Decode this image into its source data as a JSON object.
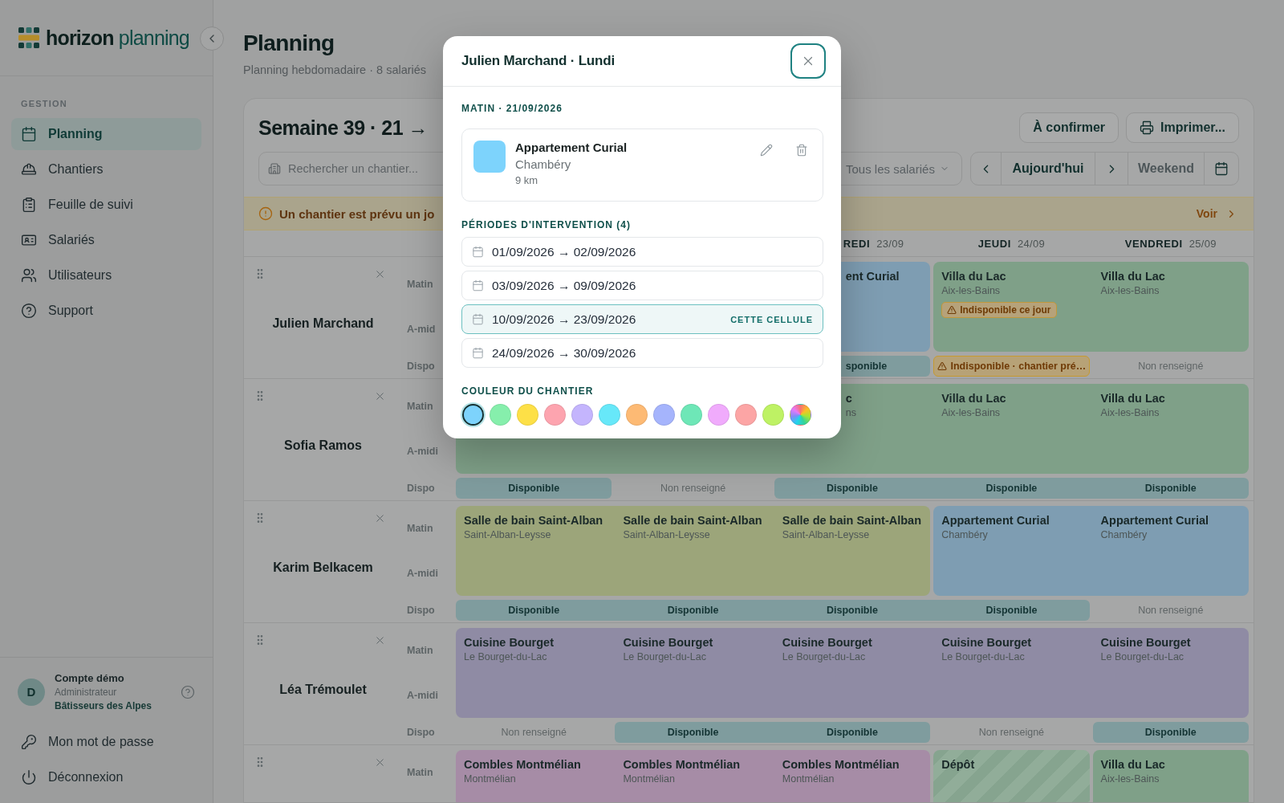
{
  "sidebar": {
    "logo": {
      "first": "horizon",
      "second": "planning"
    },
    "section": "GESTION",
    "items": [
      {
        "label": "Planning",
        "selected": true
      },
      {
        "label": "Chantiers",
        "selected": false
      },
      {
        "label": "Feuille de suivi",
        "selected": false
      },
      {
        "label": "Salariés",
        "selected": false
      },
      {
        "label": "Utilisateurs",
        "selected": false
      },
      {
        "label": "Support",
        "selected": false
      }
    ],
    "account": {
      "initial": "D",
      "name": "Compte démo",
      "role": "Administrateur",
      "company": "Bâtisseurs des Alpes"
    },
    "footer_links": [
      "Mon mot de passe",
      "Déconnexion"
    ]
  },
  "header": {
    "title": "Planning",
    "subtitle": "Planning hebdomadaire · 8 salariés"
  },
  "week": {
    "title": "Semaine 39 · 21 →",
    "actions": [
      "À confirmer",
      "Imprimer..."
    ],
    "search": {
      "placeholder": "Rechercher un chantier..."
    },
    "filter": {
      "value": "Tous les salariés"
    },
    "nav": {
      "today": "Aujourd'hui",
      "weekend": "Weekend"
    }
  },
  "alert": {
    "text": "Un chantier est prévu un jo",
    "link": "Voir"
  },
  "days": [
    {
      "day": "REDI",
      "date": "23/09"
    },
    {
      "day": "JEUDI",
      "date": "24/09"
    },
    {
      "day": "VENDREDI",
      "date": "25/09"
    }
  ],
  "rows": [
    {
      "name": "Julien Marchand",
      "labels": [
        "Matin",
        "A-mid",
        "Dispo"
      ],
      "work": [
        {
          "kind": "site",
          "color": "#7e9db2",
          "days": [
            {
              "title": "ent Curial"
            }
          ]
        },
        {
          "kind": "site",
          "color": "#7fa088",
          "days": [
            {
              "title": "Villa du Lac",
              "city": "Aix-les-Bains",
              "warning": "Indisponible ce jour"
            },
            {
              "title": "Villa du Lac",
              "city": "Aix-les-Bains"
            }
          ]
        }
      ],
      "dispo": [
        {
          "kind": "available",
          "days": [
            "sponible"
          ]
        },
        {
          "kind": "unavailable",
          "days": [
            "Indisponible · chantier pré…"
          ]
        },
        {
          "kind": "unset",
          "days": [
            "Non renseigné"
          ]
        }
      ]
    },
    {
      "name": "Sofia Ramos",
      "labels": [
        "Matin",
        "A-midi",
        "Dispo"
      ],
      "work": [
        {
          "kind": "site",
          "color": "#7fa088",
          "days": [
            {
              "title": "c",
              "city": "ns"
            },
            {
              "title": "Villa du Lac",
              "city": "Aix-les-Bains"
            },
            {
              "title": "Villa du Lac",
              "city": "Aix-les-Bains"
            }
          ]
        }
      ],
      "dispo": [
        {
          "kind": "available",
          "days": [
            "Disponible"
          ]
        },
        {
          "kind": "unset",
          "days": [
            "Non renseigné"
          ]
        },
        {
          "kind": "available",
          "days": [
            "Disponible",
            "Disponible",
            "Disponible"
          ]
        }
      ]
    },
    {
      "name": "Karim Belkacem",
      "labels": [
        "Matin",
        "A-midi",
        "Dispo"
      ],
      "work": [
        {
          "kind": "site",
          "color": "#9ca57a",
          "days": [
            {
              "title": "Salle de bain Saint-Alban",
              "city": "Saint-Alban-Leysse"
            },
            {
              "title": "Salle de bain Saint-Alban",
              "city": "Saint-Alban-Leysse"
            },
            {
              "title": "Salle de bain Saint-Alban",
              "city": "Saint-Alban-Leysse"
            }
          ]
        },
        {
          "kind": "site",
          "color": "#7e9db2",
          "days": [
            {
              "title": "Appartement Curial",
              "city": "Chambéry"
            },
            {
              "title": "Appartement Curial",
              "city": "Chambéry"
            }
          ]
        }
      ],
      "dispo": [
        {
          "kind": "available",
          "days": [
            "Disponible",
            "Disponible",
            "Disponible",
            "Disponible"
          ]
        },
        {
          "kind": "unset",
          "days": [
            "Non renseigné"
          ]
        }
      ]
    },
    {
      "name": "Léa Trémoulet",
      "labels": [
        "Matin",
        "A-midi",
        "Dispo"
      ],
      "work": [
        {
          "kind": "site",
          "color": "#8f8ba4",
          "days": [
            {
              "title": "Cuisine Bourget",
              "city": "Le Bourget-du-Lac"
            },
            {
              "title": "Cuisine Bourget",
              "city": "Le Bourget-du-Lac"
            },
            {
              "title": "Cuisine Bourget",
              "city": "Le Bourget-du-Lac"
            },
            {
              "title": "Cuisine Bourget",
              "city": "Le Bourget-du-Lac"
            },
            {
              "title": "Cuisine Bourget",
              "city": "Le Bourget-du-Lac"
            }
          ]
        }
      ],
      "dispo": [
        {
          "kind": "unset",
          "days": [
            "Non renseigné"
          ]
        },
        {
          "kind": "available",
          "days": [
            "Disponible",
            "Disponible"
          ]
        },
        {
          "kind": "unset",
          "days": [
            "Non renseigné"
          ]
        },
        {
          "kind": "available",
          "days": [
            "Disponible"
          ]
        }
      ]
    },
    {
      "labels": [
        "Matin"
      ],
      "work": [
        {
          "kind": "site",
          "color": "#a68ca6",
          "days": [
            {
              "title": "Combles Montmélian",
              "city": "Montmélian"
            },
            {
              "title": "Combles Montmélian",
              "city": "Montmélian"
            },
            {
              "title": "Combles Montmélian",
              "city": "Montmélian"
            }
          ]
        },
        {
          "kind": "depot",
          "color": "#86a48f",
          "days": [
            {
              "title": "Dépôt"
            }
          ]
        },
        {
          "kind": "site",
          "color": "#7fa088",
          "days": [
            {
              "title": "Villa du Lac",
              "city": "Aix-les-Bains"
            }
          ]
        }
      ]
    }
  ],
  "modal": {
    "title": "Julien Marchand · Lundi",
    "section": "MATIN · 21/09/2026",
    "site": {
      "name": "Appartement Curial",
      "city": "Chambéry",
      "distance": "9 km",
      "color": "#7dd3fc"
    },
    "periods_label": "PÉRIODES D'INTERVENTION (4)",
    "periods": [
      {
        "range": "01/09/2026 → 02/09/2026",
        "selected": false
      },
      {
        "range": "03/09/2026 → 09/09/2026",
        "selected": false
      },
      {
        "range": "10/09/2026 → 23/09/2026",
        "selected": true,
        "badge": "CETTE CELLULE"
      },
      {
        "range": "24/09/2026 → 30/09/2026",
        "selected": false
      }
    ],
    "color_label": "COULEUR DU CHANTIER",
    "swatches": [
      {
        "kind": "preset",
        "color": "#7dd3fc",
        "selected": true
      },
      {
        "kind": "preset",
        "color": "#86efac",
        "selected": false
      },
      {
        "kind": "preset",
        "color": "#fde047",
        "selected": false
      },
      {
        "kind": "preset",
        "color": "#fda4af",
        "selected": false
      },
      {
        "kind": "preset",
        "color": "#c4b5fd",
        "selected": false
      },
      {
        "kind": "preset",
        "color": "#67e8f9",
        "selected": false
      },
      {
        "kind": "preset",
        "color": "#fdba74",
        "selected": false
      },
      {
        "kind": "preset",
        "color": "#a5b4fc",
        "selected": false
      },
      {
        "kind": "preset",
        "color": "#6ee7b7",
        "selected": false
      },
      {
        "kind": "preset",
        "color": "#f0abfc",
        "selected": false
      },
      {
        "kind": "preset",
        "color": "#fca5a5",
        "selected": false
      },
      {
        "kind": "preset",
        "color": "#bef264",
        "selected": false
      },
      {
        "kind": "custom",
        "selected": false
      }
    ]
  }
}
